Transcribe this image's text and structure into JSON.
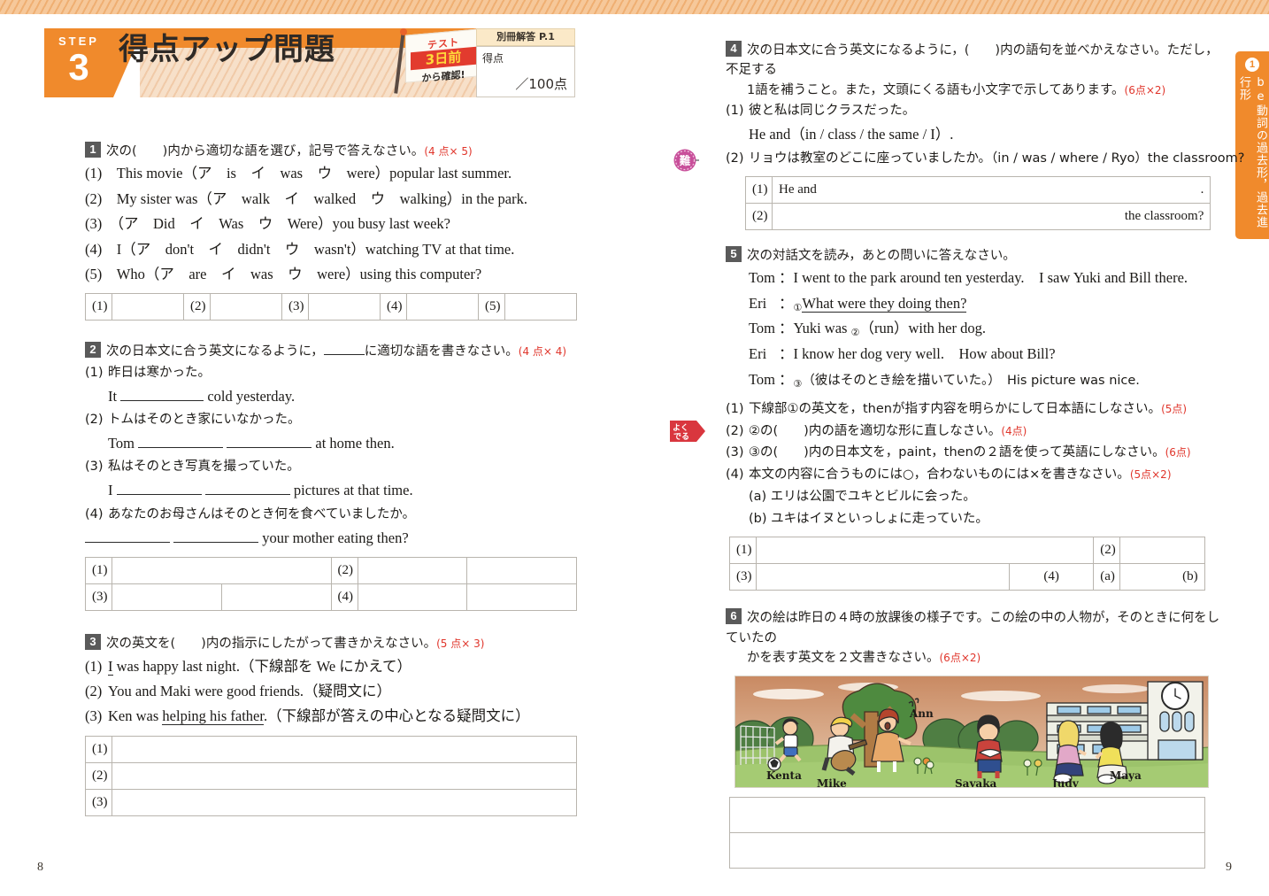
{
  "header": {
    "step_word": "STEP",
    "step_number": "3",
    "title": "得点アップ問題",
    "flag_line1": "テスト",
    "flag_line2": "3日前",
    "flag_line3": "から確認!",
    "answer_ref": "別冊解答 P.1",
    "score_label": "得点",
    "score_max": "／100点"
  },
  "side_tab": {
    "badge": "1",
    "text": "be動詞の過去形，過去進行形"
  },
  "problems": [
    {
      "num": "1",
      "instruction": "次の(　　)内から適切な語を選び，記号で答えなさい。",
      "points": "(4 点× 5)",
      "items": [
        "(1)　This movie（ア　is　イ　was　ウ　were）popular last summer.",
        "(2)　My sister was（ア　walk　イ　walked　ウ　walking）in the park.",
        "(3)　（ア　Did　イ　Was　ウ　Were）you busy last week?",
        "(4)　I（ア　don't　イ　didn't　ウ　wasn't）watching TV at that time.",
        "(5)　Who（ア　are　イ　was　ウ　were）using this computer?"
      ],
      "answer_keys": [
        "(1)",
        "(2)",
        "(3)",
        "(4)",
        "(5)"
      ]
    },
    {
      "num": "2",
      "instruction_a": "次の日本文に合う英文になるように，",
      "instruction_b": "に適切な語を書きなさい。",
      "points": "(4 点× 4)",
      "items": [
        {
          "label": "(1)",
          "ja": "昨日は寒かった。",
          "en_pre": "It ",
          "blank1": 94,
          "en_post": " cold yesterday."
        },
        {
          "label": "(2)",
          "ja": "トムはそのとき家にいなかった。",
          "en_pre": "Tom ",
          "blank1": 96,
          "blank2": 96,
          "en_post": " at home then."
        },
        {
          "label": "(3)",
          "ja": "私はそのとき写真を撮っていた。",
          "en_pre": "I ",
          "blank1": 96,
          "blank2": 96,
          "en_post": " pictures at that time."
        },
        {
          "label": "(4)",
          "ja": "あなたのお母さんはそのとき何を食べていましたか。",
          "en_pre": "",
          "blank1": 96,
          "blank2": 96,
          "en_post": " your mother eating then?"
        }
      ],
      "answer_keys": [
        "(1)",
        "(2)",
        "(3)",
        "(4)"
      ]
    },
    {
      "num": "3",
      "instruction": "次の英文を(　　)内の指示にしたがって書きかえなさい。",
      "points": "(5 点× 3)",
      "items": [
        {
          "label": "(1)",
          "pre": "",
          "ul": "I",
          "post": " was happy last night.（下線部を We にかえて）"
        },
        {
          "label": "(2)",
          "pre": "You and Maki were good friends.（疑問文に）",
          "ul": "",
          "post": ""
        },
        {
          "label": "(3)",
          "pre": "Ken was ",
          "ul": "helping his father",
          "post": ".（下線部が答えの中心となる疑問文に）"
        }
      ],
      "answer_keys": [
        "(1)",
        "(2)",
        "(3)"
      ]
    },
    {
      "num": "4",
      "instruction_l1": "次の日本文に合う英文になるように，(　　)内の語句を並べかえなさい。ただし，不足する",
      "instruction_l2": "1語を補うこと。また，文頭にくる語も小文字で示してあります。",
      "points": "(6点×2)",
      "items": [
        {
          "label": "(1)",
          "ja": "彼と私は同じクラスだった。",
          "en": "He and（in / class / the same / I）."
        },
        {
          "label": "(2)",
          "ja": "リョウは教室のどこに座っていましたか。（in / was / where / Ryo）the classroom?",
          "badge": "難"
        }
      ],
      "answer_rows": [
        {
          "key": "(1)",
          "prefill": "He and",
          "suffix": "."
        },
        {
          "key": "(2)",
          "prefill": "",
          "suffix": "the classroom?"
        }
      ]
    },
    {
      "num": "5",
      "instruction": "次の対話文を読み，あとの問いに答えなさい。",
      "dialog": [
        {
          "speaker": "Tom",
          "text": "I went to the park around ten yesterday.　I saw Yuki and Bill there."
        },
        {
          "speaker": "Eri",
          "mark": "①",
          "underline": "What were they doing then?",
          "text": ""
        },
        {
          "speaker": "Tom",
          "text": "Yuki was ",
          "mark2": "②",
          "text2": "（run）with her dog."
        },
        {
          "speaker": "Eri",
          "text": "I know her dog very well.　How about Bill?"
        },
        {
          "speaker": "Tom",
          "mark3": "③",
          "text3": "（彼はそのとき絵を描いていた。）　His picture was nice."
        }
      ],
      "subquestions": [
        {
          "label": "(1)",
          "text": "下線部①の英文を，thenが指す内容を明らかにして日本語にしなさい。",
          "points": "(5点)"
        },
        {
          "label": "(2)",
          "text": "②の(　　)内の語を適切な形に直しなさい。",
          "points": "(4点)",
          "badge": "よくでる"
        },
        {
          "label": "(3)",
          "text": "③の(　　)内の日本文を，paint，thenの２語を使って英語にしなさい。",
          "points": "(6点)"
        },
        {
          "label": "(4)",
          "text": "本文の内容に合うものには○，合わないものには×を書きなさい。",
          "points": "(5点×2)"
        }
      ],
      "truefalse": [
        "(a) エリは公園でユキとビルに会った。",
        "(b) ユキはイヌといっしょに走っていた。"
      ],
      "answer_keys": [
        "(1)",
        "(2)",
        "(3)",
        "(4)",
        "(a)",
        "(b)"
      ]
    },
    {
      "num": "6",
      "instruction_l1": "次の絵は昨日の４時の放課後の様子です。この絵の中の人物が，そのときに何をしていたの",
      "instruction_l2": "かを表す英文を２文書きなさい。",
      "points": "(6点×2)",
      "illustration": {
        "names": [
          "Kenta",
          "Mike",
          "Ann",
          "Sayaka",
          "Judy",
          "Maya"
        ],
        "clock_label": "clock-tower"
      }
    }
  ],
  "page_numbers": {
    "left": "8",
    "right": "9"
  },
  "colors": {
    "accent_orange": "#f08a2c",
    "points_red": "#e0352b",
    "badge_gray": "#5a5a5a",
    "badge_pink": "#c84f9a",
    "badge_red": "#d9363e"
  }
}
